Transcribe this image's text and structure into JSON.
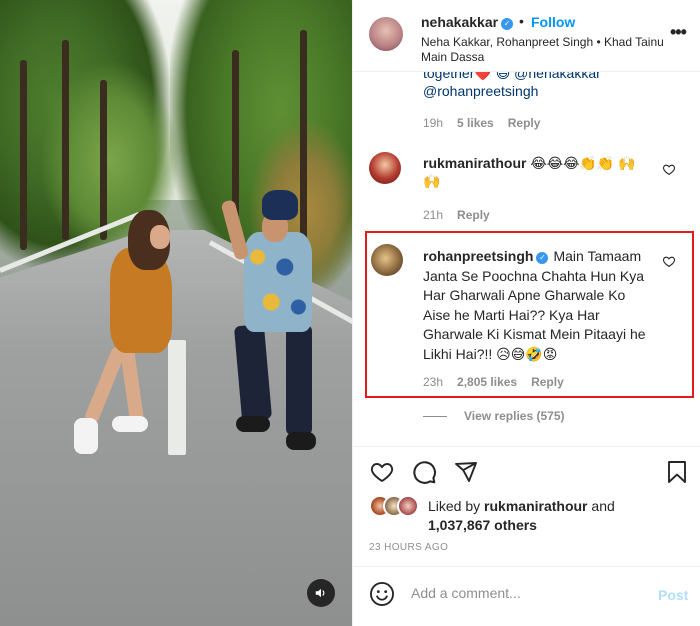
{
  "post": {
    "username": "nehakakkar",
    "follow_label": "Follow",
    "separator": "•",
    "subtitle": "Neha Kakkar, Rohanpreet Singh • Khad Tainu Main Dassa",
    "more_label": "•••"
  },
  "comments": {
    "prev": {
      "partial_line": "together❤️ 😄 @nehakakkar",
      "mention": "@rohanpreetsingh",
      "time": "19h",
      "likes": "5 likes",
      "reply_label": "Reply"
    },
    "c1": {
      "username": "rukmanirathour",
      "text": "😂😂😂👏👏 🙌🙌",
      "time": "21h",
      "reply_label": "Reply"
    },
    "c2": {
      "username": "rohanpreetsingh",
      "text": "Main Tamaam Janta Se Poochna Chahta Hun Kya Har Gharwali Apne Gharwale Ko Aise he Marti Hai?? Kya Har Gharwale Ki Kismat Mein Pitaayi he Likhi Hai?!! 😥😅🤣😡",
      "time": "23h",
      "likes": "2,805 likes",
      "reply_label": "Reply",
      "view_replies": "View replies (575)"
    }
  },
  "likes": {
    "prefix": "Liked by",
    "user": "rukmanirathour",
    "and": "and",
    "others": "1,037,867 others"
  },
  "timestamp": "23 HOURS AGO",
  "add_comment": {
    "placeholder": "Add a comment...",
    "post_label": "Post"
  },
  "colors": {
    "link_blue": "#0095f6",
    "highlight_red": "#e21b1b",
    "text": "#262626",
    "muted": "#8e8e8e"
  },
  "icons": [
    "volume-icon",
    "heart-icon",
    "comment-icon",
    "share-icon",
    "bookmark-icon",
    "smiley-icon",
    "verified-icon"
  ]
}
